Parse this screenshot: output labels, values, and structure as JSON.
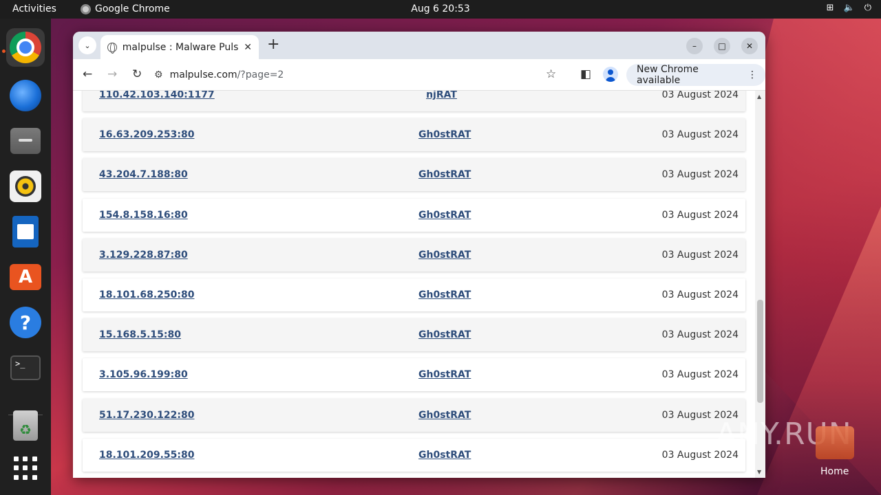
{
  "topbar": {
    "activities": "Activities",
    "app_name": "Google Chrome",
    "clock": "Aug 6  20:53"
  },
  "dock": {
    "apps": [
      "chrome-icon",
      "thunderbird-icon",
      "files-icon",
      "rhythmbox-icon",
      "libreoffice-writer-icon",
      "app-center-icon",
      "help-icon",
      "terminal-icon",
      "trash-icon",
      "show-apps-icon"
    ]
  },
  "browser": {
    "tab_title": "malpulse : Malware Pulse",
    "url_host": "malpulse.com",
    "url_path": "/?page=2",
    "update_label": "New Chrome available"
  },
  "rows": [
    {
      "ip": "110.42.103.140:1177",
      "family": "njRAT",
      "date": "03 August 2024"
    },
    {
      "ip": "16.63.209.253:80",
      "family": "Gh0stRAT",
      "date": "03 August 2024"
    },
    {
      "ip": "43.204.7.188:80",
      "family": "Gh0stRAT",
      "date": "03 August 2024"
    },
    {
      "ip": "154.8.158.16:80",
      "family": "Gh0stRAT",
      "date": "03 August 2024"
    },
    {
      "ip": "3.129.228.87:80",
      "family": "Gh0stRAT",
      "date": "03 August 2024"
    },
    {
      "ip": "18.101.68.250:80",
      "family": "Gh0stRAT",
      "date": "03 August 2024"
    },
    {
      "ip": "15.168.5.15:80",
      "family": "Gh0stRAT",
      "date": "03 August 2024"
    },
    {
      "ip": "3.105.96.199:80",
      "family": "Gh0stRAT",
      "date": "03 August 2024"
    },
    {
      "ip": "51.17.230.122:80",
      "family": "Gh0stRAT",
      "date": "03 August 2024"
    },
    {
      "ip": "18.101.209.55:80",
      "family": "Gh0stRAT",
      "date": "03 August 2024"
    }
  ],
  "desktop": {
    "watermark": "ANY.RUN",
    "home_label": "Home"
  }
}
